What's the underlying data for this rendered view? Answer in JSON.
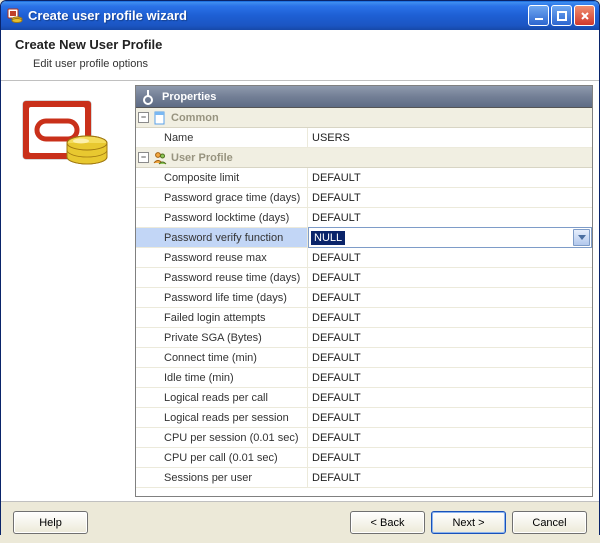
{
  "window": {
    "title": "Create user profile wizard"
  },
  "header": {
    "title": "Create New User Profile",
    "subtitle": "Edit user profile options"
  },
  "properties_panel": {
    "title": "Properties"
  },
  "groups": {
    "common": {
      "label": "Common"
    },
    "profile": {
      "label": "User Profile"
    }
  },
  "common": {
    "name_label": "Name",
    "name_value": "USERS"
  },
  "profile": {
    "composite_label": "Composite limit",
    "composite_value": "DEFAULT",
    "pw_grace_label": "Password grace time (days)",
    "pw_grace_value": "DEFAULT",
    "pw_lock_label": "Password locktime (days)",
    "pw_lock_value": "DEFAULT",
    "pw_verify_label": "Password verify function",
    "pw_verify_value": "NULL",
    "pw_reuse_max_label": "Password reuse max",
    "pw_reuse_max_value": "DEFAULT",
    "pw_reuse_time_label": "Password reuse time (days)",
    "pw_reuse_time_value": "DEFAULT",
    "pw_life_label": "Password life time (days)",
    "pw_life_value": "DEFAULT",
    "failed_login_label": "Failed login attempts",
    "failed_login_value": "DEFAULT",
    "sga_label": "Private SGA (Bytes)",
    "sga_value": "DEFAULT",
    "connect_time_label": "Connect time (min)",
    "connect_time_value": "DEFAULT",
    "idle_time_label": "Idle time (min)",
    "idle_time_value": "DEFAULT",
    "reads_call_label": "Logical reads per call",
    "reads_call_value": "DEFAULT",
    "reads_session_label": "Logical reads per session",
    "reads_session_value": "DEFAULT",
    "cpu_session_label": "CPU per session (0.01 sec)",
    "cpu_session_value": "DEFAULT",
    "cpu_call_label": "CPU per call (0.01 sec)",
    "cpu_call_value": "DEFAULT",
    "sessions_label": "Sessions per user",
    "sessions_value": "DEFAULT"
  },
  "buttons": {
    "help": "Help",
    "back": "< Back",
    "next": "Next >",
    "cancel": "Cancel"
  }
}
